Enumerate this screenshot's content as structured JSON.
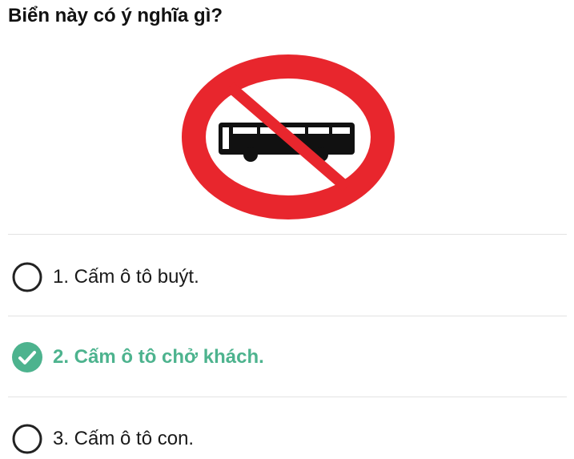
{
  "question": {
    "text": "Biển này có ý nghĩa gì?"
  },
  "sign": {
    "icon": "no-bus-sign-icon",
    "ring_color": "#e8262d",
    "bus_color": "#111111"
  },
  "answers": [
    {
      "label": "1. Cấm ô tô buýt.",
      "selected": false,
      "icon": "radio-empty-icon"
    },
    {
      "label": "2. Cấm ô tô chở khách.",
      "selected": true,
      "icon": "check-circle-icon"
    },
    {
      "label": "3. Cấm ô tô con.",
      "selected": false,
      "icon": "radio-empty-icon"
    }
  ],
  "colors": {
    "selected_accent": "#4db38e",
    "divider": "#e2e2e2",
    "text": "#1a1a1a"
  }
}
